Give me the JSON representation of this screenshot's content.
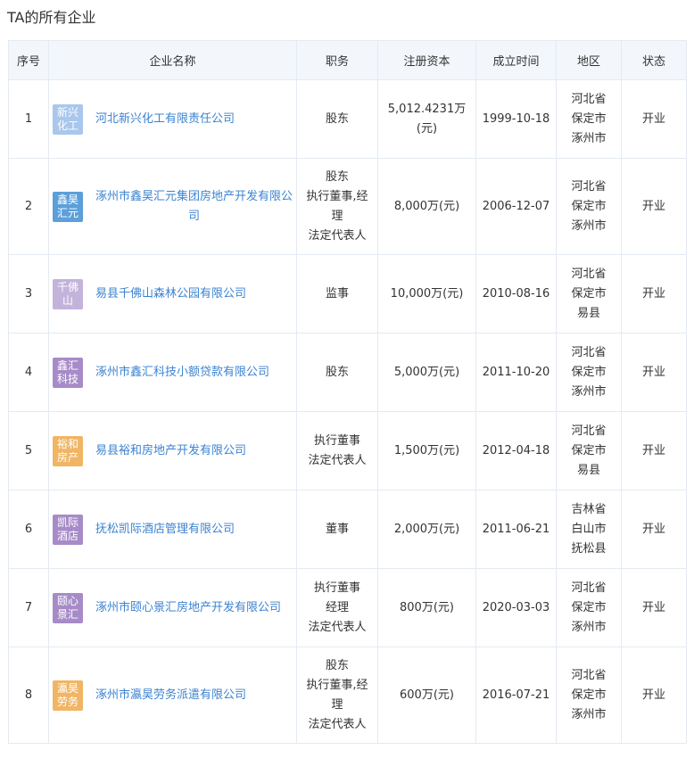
{
  "section_title": "TA的所有企业",
  "columns": [
    "序号",
    "企业名称",
    "职务",
    "注册资本",
    "成立时间",
    "地区",
    "状态"
  ],
  "rows": [
    {
      "index": "1",
      "logo_text": "新兴化工",
      "logo_color": "#a9c7ec",
      "name": "河北新兴化工有限责任公司",
      "roles": [
        "股东"
      ],
      "capital": "5,012.4231万(元)",
      "founded": "1999-10-18",
      "region": [
        "河北省",
        "保定市",
        "涿州市"
      ],
      "status": "开业"
    },
    {
      "index": "2",
      "logo_text": "鑫昊汇元",
      "logo_color": "#5c9fd9",
      "name": "涿州市鑫昊汇元集团房地产开发有限公司",
      "roles": [
        "股东",
        "执行董事,经理",
        "法定代表人"
      ],
      "capital": "8,000万(元)",
      "founded": "2006-12-07",
      "region": [
        "河北省",
        "保定市",
        "涿州市"
      ],
      "status": "开业"
    },
    {
      "index": "3",
      "logo_text": "千佛山",
      "logo_color": "#c3b3da",
      "name": "易县千佛山森林公园有限公司",
      "roles": [
        "监事"
      ],
      "capital": "10,000万(元)",
      "founded": "2010-08-16",
      "region": [
        "河北省",
        "保定市",
        "易县"
      ],
      "status": "开业"
    },
    {
      "index": "4",
      "logo_text": "鑫汇科技",
      "logo_color": "#a78bc8",
      "name": "涿州市鑫汇科技小额贷款有限公司",
      "roles": [
        "股东"
      ],
      "capital": "5,000万(元)",
      "founded": "2011-10-20",
      "region": [
        "河北省",
        "保定市",
        "涿州市"
      ],
      "status": "开业"
    },
    {
      "index": "5",
      "logo_text": "裕和房产",
      "logo_color": "#f0b565",
      "name": "易县裕和房地产开发有限公司",
      "roles": [
        "执行董事",
        "法定代表人"
      ],
      "capital": "1,500万(元)",
      "founded": "2012-04-18",
      "region": [
        "河北省",
        "保定市",
        "易县"
      ],
      "status": "开业"
    },
    {
      "index": "6",
      "logo_text": "凯际酒店",
      "logo_color": "#a78bc8",
      "name": "抚松凯际酒店管理有限公司",
      "roles": [
        "董事"
      ],
      "capital": "2,000万(元)",
      "founded": "2011-06-21",
      "region": [
        "吉林省",
        "白山市",
        "抚松县"
      ],
      "status": "开业"
    },
    {
      "index": "7",
      "logo_text": "颐心景汇",
      "logo_color": "#a78bc8",
      "name": "涿州市颐心景汇房地产开发有限公司",
      "roles": [
        "执行董事",
        "经理",
        "法定代表人"
      ],
      "capital": "800万(元)",
      "founded": "2020-03-03",
      "region": [
        "河北省",
        "保定市",
        "涿州市"
      ],
      "status": "开业"
    },
    {
      "index": "8",
      "logo_text": "瀛昊劳务",
      "logo_color": "#f0b565",
      "name": "涿州市瀛昊劳务派遣有限公司",
      "roles": [
        "股东",
        "执行董事,经理",
        "法定代表人"
      ],
      "capital": "600万(元)",
      "founded": "2016-07-21",
      "region": [
        "河北省",
        "保定市",
        "涿州市"
      ],
      "status": "开业"
    }
  ]
}
